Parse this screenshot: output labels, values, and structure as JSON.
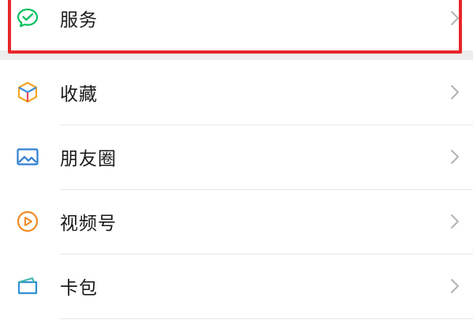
{
  "menu": {
    "items": [
      {
        "label": "服务",
        "icon": "service-check-icon",
        "color": "#07c160"
      },
      {
        "label": "收藏",
        "icon": "favorites-cube-icon",
        "color": "#f5a623"
      },
      {
        "label": "朋友圈",
        "icon": "moments-image-icon",
        "color": "#2f7fd4"
      },
      {
        "label": "视频号",
        "icon": "channels-play-icon",
        "color": "#f08a24"
      },
      {
        "label": "卡包",
        "icon": "card-wallet-icon",
        "color": "#2f8fd4"
      }
    ]
  },
  "colors": {
    "highlight_border": "#e8262a",
    "background": "#ededed",
    "row_bg": "#ffffff"
  }
}
